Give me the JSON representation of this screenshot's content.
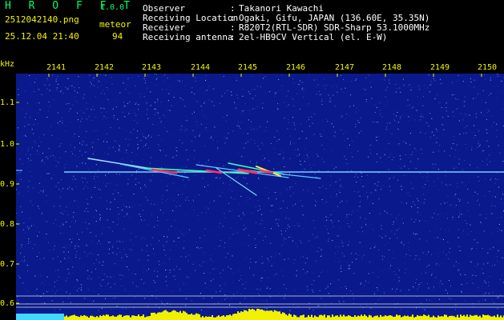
{
  "header": {
    "app_title": "H R O F F T",
    "app_version": "1.0.0",
    "filename": "2512042140.png",
    "timestamp": "25.12.04 21:40",
    "meteor_label": "meteor",
    "meteor_count": "94"
  },
  "info": [
    {
      "label": "Observer",
      "value": "Takanori Kawachi"
    },
    {
      "label": "Receiving Location",
      "value": "Ogaki, Gifu, JAPAN (136.60E, 35.35N)"
    },
    {
      "label": "Receiver",
      "value": "R820T2(RTL-SDR) SDR-Sharp 53.1000MHz"
    },
    {
      "label": "Receiving antenna",
      "value": "2el-HB9CV Vertical (el. E-W)"
    }
  ],
  "separator": ":",
  "axis": {
    "y_unit": "kHz",
    "y_ticks": [
      "1.1",
      "1.0",
      "0.9",
      "0.8",
      "0.7",
      "0.6"
    ],
    "x_ticks": [
      "2141",
      "2142",
      "2143",
      "2144",
      "2145",
      "2146",
      "2147",
      "2148",
      "2149",
      "2150"
    ]
  },
  "colors": {
    "background": "#0a1a8c",
    "label": "#f4f400",
    "carrier": "#7ad0ff",
    "meteor": "#ff3060",
    "spectrum": "#f0f000"
  }
}
